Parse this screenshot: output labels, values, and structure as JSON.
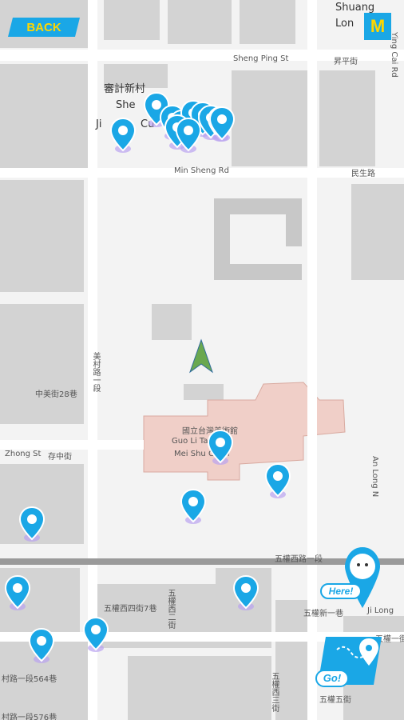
{
  "map": {
    "places": {
      "shuang_long": [
        "Shuang",
        "Lon"
      ],
      "shen_ji": "審計新村",
      "shen_ji_en": [
        "She",
        "Ji",
        "Cu"
      ],
      "museum_zh": "國立台灣美術館",
      "museum_en": [
        "Guo Li Tai Wan",
        "Mei Shu Guan"
      ]
    },
    "streets": [
      "Sheng Ping St",
      "昇平街",
      "Min Sheng Rd",
      "民生路",
      "Zhong St",
      "存中街",
      "中美街28巷",
      "五權西路一段",
      "五權西四街7巷",
      "五權新一巷",
      "Ji Long",
      "五權一街",
      "五權五街",
      "Ying Cai Rd",
      "An Long N",
      "美村路一段",
      "村路一段564巷",
      "村路一段576巷",
      "五權西二街",
      "五權西三街"
    ]
  },
  "controls": {
    "back_label": "BACK",
    "menu_label": "M",
    "here_label": "Here!",
    "go_label": "Go!"
  },
  "colors": {
    "pin": "#1aa7e6",
    "pin_glow": "#b9a3f0",
    "museum": "#f0cfc8",
    "button_bg": "#1aa7e6",
    "button_text": "#ffd600"
  }
}
